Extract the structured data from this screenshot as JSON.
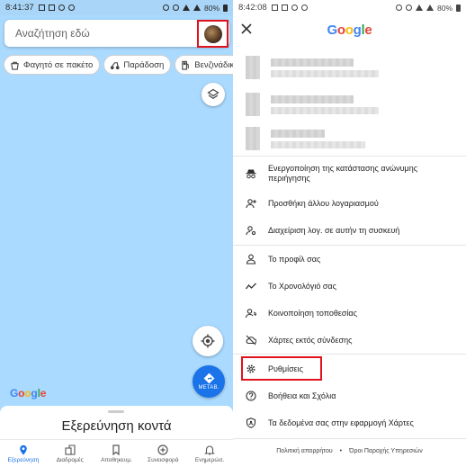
{
  "left_phone": {
    "status": {
      "time": "8:41:37",
      "battery": "80%"
    },
    "search": {
      "placeholder": "Αναζήτηση εδώ"
    },
    "chips": [
      {
        "label": "Φαγητό σε πακέτο",
        "icon": "takeout-icon"
      },
      {
        "label": "Παράδοση",
        "icon": "delivery-icon"
      },
      {
        "label": "Βενζινάδικα",
        "icon": "gas-station-icon"
      }
    ],
    "directions_label": "ΜΕΤΑΒ.",
    "map_logo": "Google",
    "sheet_title": "Εξερεύνηση κοντά",
    "nav": [
      {
        "label": "Εξερεύνηση",
        "icon": "pin-icon",
        "active": true
      },
      {
        "label": "Διαδρομές",
        "icon": "commute-icon",
        "active": false
      },
      {
        "label": "Αποθηκευμ.",
        "icon": "bookmark-icon",
        "active": false
      },
      {
        "label": "Συνεισφορά",
        "icon": "add-circle-icon",
        "active": false
      },
      {
        "label": "Ενημερώσ.",
        "icon": "bell-icon",
        "active": false
      }
    ]
  },
  "right_phone": {
    "status": {
      "time": "8:42:08",
      "battery": "80%"
    },
    "logo": "Google",
    "menu": [
      {
        "label": "Ενεργοποίηση της κατάστασης ανώνυμης περιήγησης",
        "icon": "incognito-icon"
      },
      {
        "label": "Προσθήκη άλλου λογαριασμού",
        "icon": "add-person-icon"
      },
      {
        "label": "Διαχείριση λογ. σε αυτήν τη συσκευή",
        "icon": "manage-accounts-icon"
      },
      {
        "label": "Το προφίλ σας",
        "icon": "person-icon"
      },
      {
        "label": "Το Χρονολόγιό σας",
        "icon": "timeline-icon"
      },
      {
        "label": "Κοινοποίηση τοποθεσίας",
        "icon": "share-location-icon"
      },
      {
        "label": "Χάρτες εκτός σύνδεσης",
        "icon": "offline-maps-icon"
      },
      {
        "label": "Ρυθμίσεις",
        "icon": "gear-icon"
      },
      {
        "label": "Βοήθεια και Σχόλια",
        "icon": "help-icon"
      },
      {
        "label": "Τα δεδομένα σας στην εφαρμογή Χάρτες",
        "icon": "shield-icon"
      }
    ],
    "footer": {
      "privacy": "Πολιτική απορρήτου",
      "sep": "•",
      "terms": "Όροι Παροχής Υπηρεσιών"
    }
  },
  "colors": {
    "map_water": "#aadaff",
    "accent": "#1a73e8",
    "highlight": "#e0121c"
  }
}
